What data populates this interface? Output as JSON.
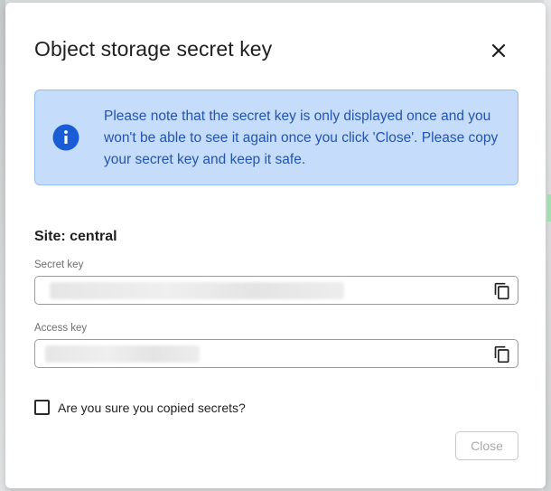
{
  "dialog": {
    "title": "Object storage secret key",
    "close_icon": "close-icon"
  },
  "info": {
    "icon": "info-icon",
    "message": "Please note that the secret key is only displayed once and you won't be able to see it again once you click 'Close'. Please copy your secret key and keep it safe."
  },
  "site": {
    "label": "Site: central"
  },
  "fields": {
    "secret_key": {
      "label": "Secret key",
      "value": "",
      "copy_icon": "copy-icon"
    },
    "access_key": {
      "label": "Access key",
      "value": "",
      "copy_icon": "copy-icon"
    }
  },
  "confirm": {
    "label": "Are you sure you copied secrets?",
    "checked": false
  },
  "actions": {
    "close_label": "Close",
    "close_disabled": true
  },
  "colors": {
    "info_bg": "#c5dcfb",
    "info_border": "#92bdf2",
    "info_text": "#2354b0",
    "info_icon": "#1a5bd6"
  }
}
